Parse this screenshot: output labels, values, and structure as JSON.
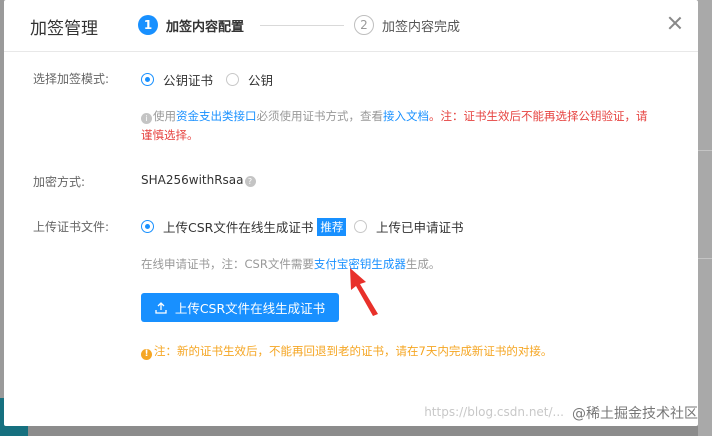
{
  "dialog": {
    "title": "加签管理",
    "steps": [
      {
        "num": "1",
        "label": "加签内容配置"
      },
      {
        "num": "2",
        "label": "加签内容完成"
      }
    ]
  },
  "mode": {
    "label": "选择加签模式:",
    "options": [
      "公钥证书",
      "公钥"
    ],
    "selected": "公钥证书",
    "note": {
      "t1": "使用",
      "link1": "资金支出类接口",
      "t2": "必须使用证书方式，查看",
      "link2": "接入文档",
      "t3": "。",
      "warn_line1": "注：证书生效后不能再选择公钥验证，请",
      "warn_line2": "谨慎选择。"
    }
  },
  "encryption": {
    "label": "加密方式:",
    "value": "SHA256withRsaa"
  },
  "upload": {
    "label": "上传证书文件:",
    "options": [
      "上传CSR文件在线生成证书",
      "上传已申请证书"
    ],
    "badge": "推荐",
    "note_prefix": "在线申请证书，注：CSR文件需要",
    "note_link": "支付宝密钥生成器",
    "note_suffix": "生成。",
    "button_label": "上传CSR文件在线生成证书"
  },
  "warning": "注：新的证书生效后，不能再回退到老的证书，请在7天内完成新证书的对接。",
  "watermark": {
    "url": "https://blog.csdn.net/...",
    "brand": "@稀土掘金技术社区"
  },
  "colors": {
    "primary": "#1890ff",
    "danger": "#e64340",
    "warning": "#f5a623",
    "arrow": "#e8302a"
  }
}
